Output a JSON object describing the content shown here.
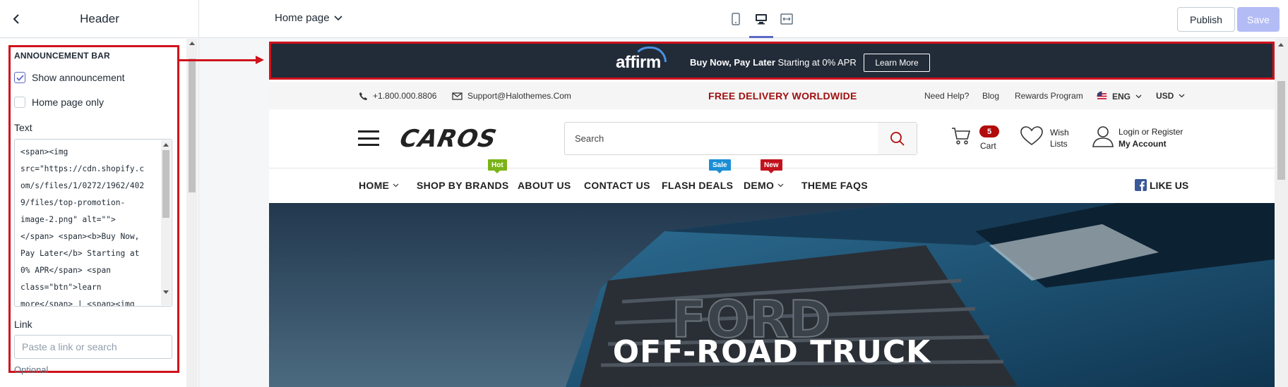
{
  "topbar": {
    "panel_title": "Header",
    "page_selector": "Home page",
    "publish_label": "Publish",
    "save_label": "Save"
  },
  "sidebar": {
    "section_title": "ANNOUNCEMENT BAR",
    "show_announcement": {
      "label": "Show announcement",
      "checked": true
    },
    "home_page_only": {
      "label": "Home page only",
      "checked": false
    },
    "text_label": "Text",
    "text_value": "<span><img\nsrc=\"https://cdn.shopify.c\nom/s/files/1/0272/1962/402\n9/files/top-promotion-\nimage-2.png\" alt=\"\">\n</span> <span><b>Buy Now,\nPay Later</b> Starting at\n0% APR</span> <span\nclass=\"btn\">learn\nmore</span> | <span><img",
    "link_label": "Link",
    "link_placeholder": "Paste a link or search",
    "next_label": "Optional"
  },
  "preview": {
    "announcement": {
      "logo_text": "affirm",
      "message_bold": "Buy Now, Pay Later",
      "message_rest": " Starting at 0% APR",
      "button": "Learn More"
    },
    "topstrip": {
      "phone": "+1.800.000.8806",
      "email": "Support@Halothemes.Com",
      "promo": "FREE DELIVERY WORLDWIDE",
      "links": [
        "Need Help?",
        "Blog",
        "Rewards Program"
      ],
      "language": "ENG",
      "currency": "USD"
    },
    "header": {
      "logo": "CAROS",
      "search_placeholder": "Search",
      "cart_count": "5",
      "cart_label": "Cart",
      "wish_line1": "Wish",
      "wish_line2": "Lists",
      "account_line1": "Login or Register",
      "account_line2": "My Account"
    },
    "nav": {
      "items": [
        "HOME",
        "SHOP BY BRANDS",
        "ABOUT US",
        "CONTACT US",
        "FLASH DEALS",
        "DEMO",
        "THEME FAQS"
      ],
      "tags": {
        "hot": "Hot",
        "sale": "Sale",
        "new": "New"
      },
      "like": "LIKE US"
    },
    "hero": {
      "title": "OFF-ROAD TRUCK",
      "grille_text": "FORD"
    }
  },
  "colors": {
    "accent": "#5c6ac4",
    "highlight_red": "#d0121b",
    "announcement_bg": "#222b38",
    "promo_red": "#a01010",
    "tag_hot": "#7ab317",
    "tag_sale": "#1a8ed6",
    "tag_new": "#c2121d"
  },
  "icons": [
    "chevron-left-icon",
    "chevron-down-icon",
    "mobile-icon",
    "desktop-icon",
    "fullwidth-icon",
    "checkmark-icon",
    "phone-icon",
    "mail-icon",
    "flag-us-icon",
    "menu-icon",
    "search-icon",
    "cart-icon",
    "heart-icon",
    "user-icon",
    "facebook-icon"
  ]
}
